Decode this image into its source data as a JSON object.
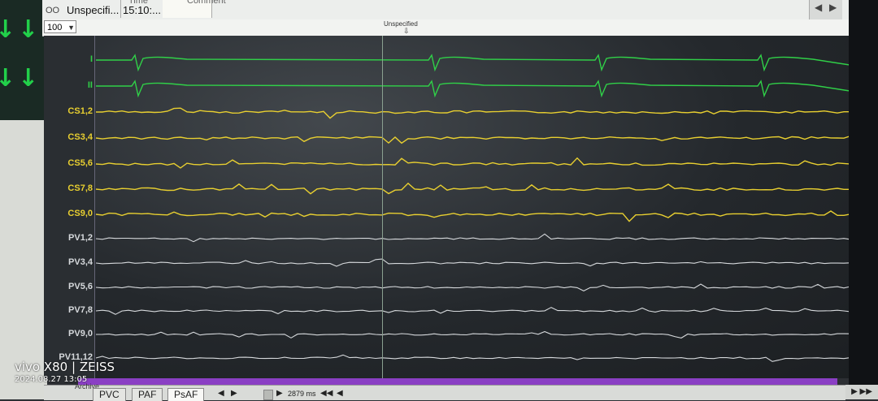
{
  "window": {
    "table": {
      "headers": [
        "Time",
        "Comment"
      ],
      "row": {
        "name": "Unspecifi...",
        "time": "15:10:..."
      }
    },
    "zoom_value": "100",
    "marker_label": "Unspecified"
  },
  "channels": [
    {
      "label": "I",
      "color": "#30d048"
    },
    {
      "label": "II",
      "color": "#30d048"
    },
    {
      "label": "CS1,2",
      "color": "#e8cf30"
    },
    {
      "label": "CS3,4",
      "color": "#e8cf30"
    },
    {
      "label": "CS5,6",
      "color": "#e8cf30"
    },
    {
      "label": "CS7,8",
      "color": "#e8cf30"
    },
    {
      "label": "CS9,0",
      "color": "#e8cf30"
    },
    {
      "label": "PV1,2",
      "color": "#d6d9dc"
    },
    {
      "label": "PV3,4",
      "color": "#d6d9dc"
    },
    {
      "label": "PV5,6",
      "color": "#d6d9dc"
    },
    {
      "label": "PV7,8",
      "color": "#d6d9dc"
    },
    {
      "label": "PV9,0",
      "color": "#d6d9dc"
    },
    {
      "label": "PV11,12",
      "color": "#d6d9dc"
    }
  ],
  "bottom": {
    "archive_label": "Archive",
    "tabs": [
      "PVC",
      "PAF",
      "PsAF"
    ],
    "active_tab": "PsAF",
    "time_span": "2879 ms",
    "nav_prev_prev": "◀◀",
    "nav_prev": "◀",
    "nav_next": "▶",
    "nav_next_next": "▶▶"
  },
  "watermark": {
    "brand": "vivo X80 | ZEISS",
    "datetime": "2024.08.27 13:05"
  },
  "colors": {
    "ecg": "#30d048",
    "cs": "#e8cf30",
    "pv": "#d6d9dc",
    "timeline": "#8a3fc4"
  }
}
